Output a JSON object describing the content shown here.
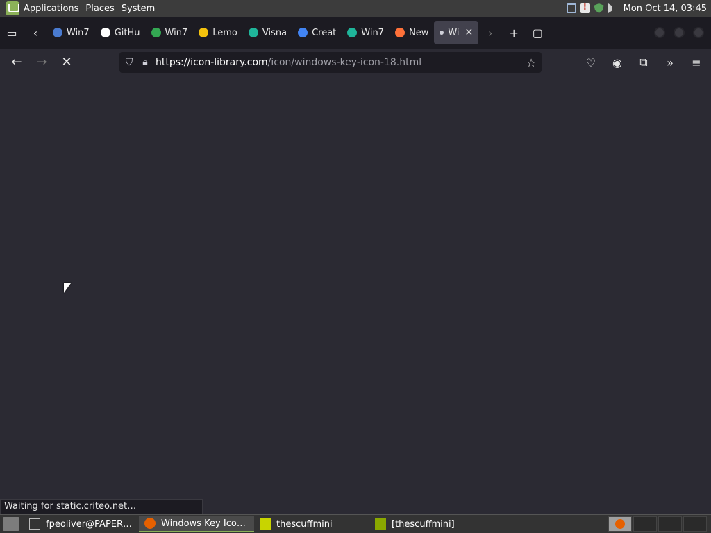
{
  "topbar": {
    "menus": [
      "Applications",
      "Places",
      "System"
    ],
    "clock": "Mon Oct 14, 03:45"
  },
  "tabs": [
    {
      "label": "Win7",
      "favicon_color": "#4a7bd0"
    },
    {
      "label": "GitHu",
      "favicon_color": "#ffffff"
    },
    {
      "label": "Win7",
      "favicon_color": "#34a853"
    },
    {
      "label": "Lemo",
      "favicon_color": "#f4c20d"
    },
    {
      "label": "Visna",
      "favicon_color": "#1fb59a"
    },
    {
      "label": "Creat",
      "favicon_color": "#4285f4"
    },
    {
      "label": "Win7",
      "favicon_color": "#1fb59a"
    },
    {
      "label": "New",
      "favicon_color": "#ff7139"
    },
    {
      "label": "Wi",
      "favicon_color": "#cfcfd8",
      "active": true
    }
  ],
  "navbar": {
    "url_host": "https://icon-library.com",
    "url_path": "/icon/windows-key-icon-18.html"
  },
  "status": {
    "text": "Waiting for static.criteo.net…"
  },
  "taskbar": {
    "tasks": [
      {
        "label": "fpeoliver@PAPERS…",
        "icon": "terminal-icon",
        "color": "#555555"
      },
      {
        "label": "Windows Key Icon #…",
        "icon": "firefox-icon",
        "color": "#e66000",
        "active": true
      },
      {
        "label": "thescuffmini",
        "icon": "app-icon",
        "color": "#c8d400"
      },
      {
        "label": "[thescuffmini]",
        "icon": "app-icon",
        "color": "#8aa800"
      }
    ]
  }
}
